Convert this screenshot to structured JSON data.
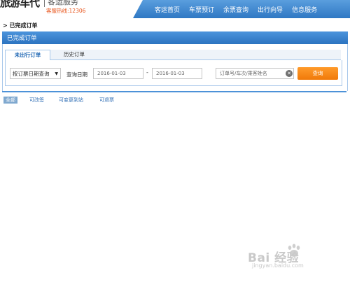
{
  "header": {
    "logo_text": "旅游车代",
    "logo_sub": "客运服务",
    "hotline": "客服热线:12306",
    "nav": [
      "客运首页",
      "车票预订",
      "余票查询",
      "出行向导",
      "信息服务"
    ]
  },
  "breadcrumb": "> 已完成订单",
  "panel": {
    "title": "已完成订单",
    "tabs": [
      "未出行订单",
      "历史订单"
    ],
    "search": {
      "type_select": "按订票日期查询",
      "date_label": "查询日期",
      "date_from": "2016-01-03",
      "date_sep": "-",
      "date_to": "2016-01-03",
      "keyword_placeholder": "订单号/车次/乘客姓名",
      "query_button": "查询"
    }
  },
  "filters": [
    "全部",
    "可改签",
    "可变更到站",
    "可退票"
  ],
  "watermark": {
    "text": "Bai 经验",
    "url": "jingyan.baidu.com"
  },
  "colors": {
    "nav_blue": "#2f78c4",
    "query_orange": "#f58a12",
    "hotline_red": "#e8551c"
  }
}
